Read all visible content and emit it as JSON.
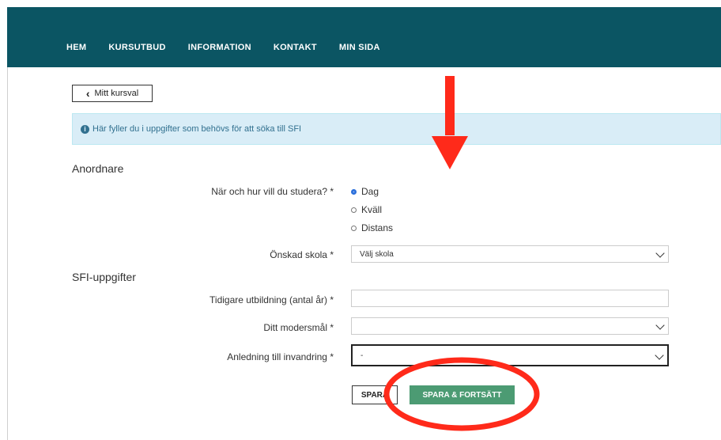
{
  "nav": [
    "HEM",
    "KURSUTBUD",
    "INFORMATION",
    "KONTAKT",
    "MIN SIDA"
  ],
  "back_button": "Mitt kursval",
  "info_text": "Här fyller du i uppgifter som behövs för att söka till SFI",
  "sections": {
    "anordnare": "Anordnare",
    "sfi": "SFI-uppgifter"
  },
  "study_question": "När och hur vill du studera? *",
  "study_options": [
    "Dag",
    "Kväll",
    "Distans"
  ],
  "selected_option": "Dag",
  "school_label": "Önskad skola *",
  "school_value": "Välj skola",
  "education_label": "Tidigare utbildning (antal år) *",
  "education_value": "",
  "language_label": "Ditt modersmål *",
  "language_value": "",
  "reason_label": "Anledning till invandring *",
  "reason_value": "-",
  "buttons": {
    "save": "SPARA",
    "save_continue": "SPARA & FORTSÄTT"
  },
  "colors": {
    "topbar": "#0b5563",
    "annotation": "#ff2a1a",
    "primary_button": "#4c9b73"
  }
}
